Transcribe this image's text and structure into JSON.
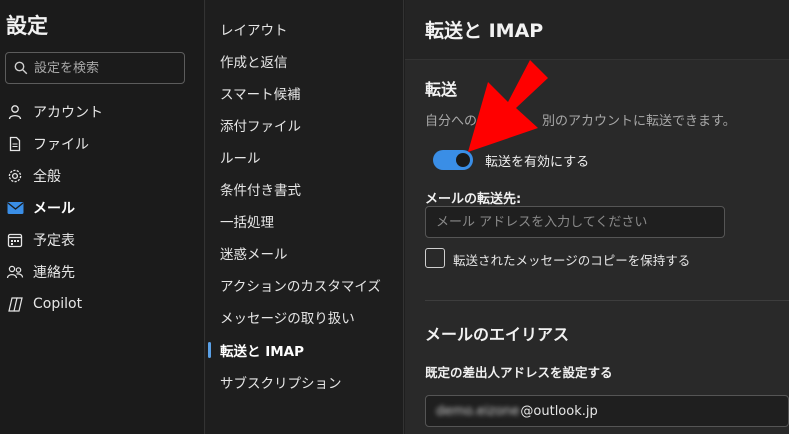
{
  "sidebar": {
    "title": "設定",
    "search_placeholder": "設定を検索",
    "items": [
      {
        "label": "アカウント",
        "icon": "person-icon"
      },
      {
        "label": "ファイル",
        "icon": "file-icon"
      },
      {
        "label": "全般",
        "icon": "gear-icon"
      },
      {
        "label": "メール",
        "icon": "mail-icon",
        "active": true
      },
      {
        "label": "予定表",
        "icon": "calendar-icon"
      },
      {
        "label": "連絡先",
        "icon": "people-icon"
      },
      {
        "label": "Copilot",
        "icon": "copilot-icon"
      }
    ]
  },
  "mail_menu": {
    "items": [
      "レイアウト",
      "作成と返信",
      "スマート候補",
      "添付ファイル",
      "ルール",
      "条件付き書式",
      "一括処理",
      "迷惑メール",
      "アクションのカスタマイズ",
      "メッセージの取り扱い",
      "転送と IMAP",
      "サブスクリプション"
    ],
    "active_index": 10
  },
  "main": {
    "header": "転送と IMAP",
    "forwarding": {
      "title": "転送",
      "description": "自分への　　　　　別のアカウントに転送できます。",
      "toggle_label": "転送を有効にする",
      "toggle_on": true,
      "field_label": "メールの転送先:",
      "field_placeholder": "メール アドレスを入力してください",
      "checkbox_label": "転送されたメッセージのコピーを保持する"
    },
    "alias": {
      "title": "メールのエイリアス",
      "sub_label": "既定の差出人アドレスを設定する",
      "address_blurred": "demo.eizone",
      "address_domain": "@outlook.jp"
    }
  },
  "colors": {
    "accent": "#3a8ee6",
    "arrow": "#ff0000"
  }
}
